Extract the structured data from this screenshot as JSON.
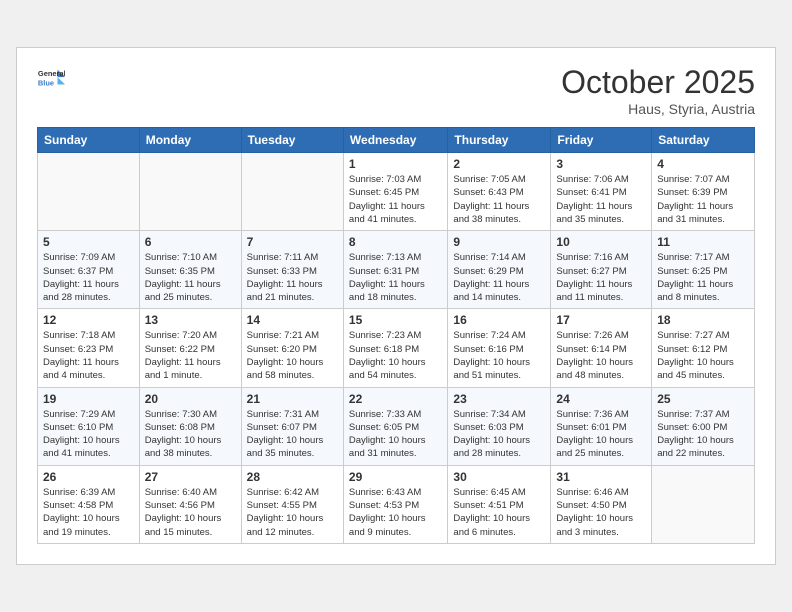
{
  "header": {
    "logo_line1": "General",
    "logo_line2": "Blue",
    "month": "October 2025",
    "location": "Haus, Styria, Austria"
  },
  "weekdays": [
    "Sunday",
    "Monday",
    "Tuesday",
    "Wednesday",
    "Thursday",
    "Friday",
    "Saturday"
  ],
  "weeks": [
    [
      {
        "day": "",
        "info": ""
      },
      {
        "day": "",
        "info": ""
      },
      {
        "day": "",
        "info": ""
      },
      {
        "day": "1",
        "info": "Sunrise: 7:03 AM\nSunset: 6:45 PM\nDaylight: 11 hours\nand 41 minutes."
      },
      {
        "day": "2",
        "info": "Sunrise: 7:05 AM\nSunset: 6:43 PM\nDaylight: 11 hours\nand 38 minutes."
      },
      {
        "day": "3",
        "info": "Sunrise: 7:06 AM\nSunset: 6:41 PM\nDaylight: 11 hours\nand 35 minutes."
      },
      {
        "day": "4",
        "info": "Sunrise: 7:07 AM\nSunset: 6:39 PM\nDaylight: 11 hours\nand 31 minutes."
      }
    ],
    [
      {
        "day": "5",
        "info": "Sunrise: 7:09 AM\nSunset: 6:37 PM\nDaylight: 11 hours\nand 28 minutes."
      },
      {
        "day": "6",
        "info": "Sunrise: 7:10 AM\nSunset: 6:35 PM\nDaylight: 11 hours\nand 25 minutes."
      },
      {
        "day": "7",
        "info": "Sunrise: 7:11 AM\nSunset: 6:33 PM\nDaylight: 11 hours\nand 21 minutes."
      },
      {
        "day": "8",
        "info": "Sunrise: 7:13 AM\nSunset: 6:31 PM\nDaylight: 11 hours\nand 18 minutes."
      },
      {
        "day": "9",
        "info": "Sunrise: 7:14 AM\nSunset: 6:29 PM\nDaylight: 11 hours\nand 14 minutes."
      },
      {
        "day": "10",
        "info": "Sunrise: 7:16 AM\nSunset: 6:27 PM\nDaylight: 11 hours\nand 11 minutes."
      },
      {
        "day": "11",
        "info": "Sunrise: 7:17 AM\nSunset: 6:25 PM\nDaylight: 11 hours\nand 8 minutes."
      }
    ],
    [
      {
        "day": "12",
        "info": "Sunrise: 7:18 AM\nSunset: 6:23 PM\nDaylight: 11 hours\nand 4 minutes."
      },
      {
        "day": "13",
        "info": "Sunrise: 7:20 AM\nSunset: 6:22 PM\nDaylight: 11 hours\nand 1 minute."
      },
      {
        "day": "14",
        "info": "Sunrise: 7:21 AM\nSunset: 6:20 PM\nDaylight: 10 hours\nand 58 minutes."
      },
      {
        "day": "15",
        "info": "Sunrise: 7:23 AM\nSunset: 6:18 PM\nDaylight: 10 hours\nand 54 minutes."
      },
      {
        "day": "16",
        "info": "Sunrise: 7:24 AM\nSunset: 6:16 PM\nDaylight: 10 hours\nand 51 minutes."
      },
      {
        "day": "17",
        "info": "Sunrise: 7:26 AM\nSunset: 6:14 PM\nDaylight: 10 hours\nand 48 minutes."
      },
      {
        "day": "18",
        "info": "Sunrise: 7:27 AM\nSunset: 6:12 PM\nDaylight: 10 hours\nand 45 minutes."
      }
    ],
    [
      {
        "day": "19",
        "info": "Sunrise: 7:29 AM\nSunset: 6:10 PM\nDaylight: 10 hours\nand 41 minutes."
      },
      {
        "day": "20",
        "info": "Sunrise: 7:30 AM\nSunset: 6:08 PM\nDaylight: 10 hours\nand 38 minutes."
      },
      {
        "day": "21",
        "info": "Sunrise: 7:31 AM\nSunset: 6:07 PM\nDaylight: 10 hours\nand 35 minutes."
      },
      {
        "day": "22",
        "info": "Sunrise: 7:33 AM\nSunset: 6:05 PM\nDaylight: 10 hours\nand 31 minutes."
      },
      {
        "day": "23",
        "info": "Sunrise: 7:34 AM\nSunset: 6:03 PM\nDaylight: 10 hours\nand 28 minutes."
      },
      {
        "day": "24",
        "info": "Sunrise: 7:36 AM\nSunset: 6:01 PM\nDaylight: 10 hours\nand 25 minutes."
      },
      {
        "day": "25",
        "info": "Sunrise: 7:37 AM\nSunset: 6:00 PM\nDaylight: 10 hours\nand 22 minutes."
      }
    ],
    [
      {
        "day": "26",
        "info": "Sunrise: 6:39 AM\nSunset: 4:58 PM\nDaylight: 10 hours\nand 19 minutes."
      },
      {
        "day": "27",
        "info": "Sunrise: 6:40 AM\nSunset: 4:56 PM\nDaylight: 10 hours\nand 15 minutes."
      },
      {
        "day": "28",
        "info": "Sunrise: 6:42 AM\nSunset: 4:55 PM\nDaylight: 10 hours\nand 12 minutes."
      },
      {
        "day": "29",
        "info": "Sunrise: 6:43 AM\nSunset: 4:53 PM\nDaylight: 10 hours\nand 9 minutes."
      },
      {
        "day": "30",
        "info": "Sunrise: 6:45 AM\nSunset: 4:51 PM\nDaylight: 10 hours\nand 6 minutes."
      },
      {
        "day": "31",
        "info": "Sunrise: 6:46 AM\nSunset: 4:50 PM\nDaylight: 10 hours\nand 3 minutes."
      },
      {
        "day": "",
        "info": ""
      }
    ]
  ]
}
